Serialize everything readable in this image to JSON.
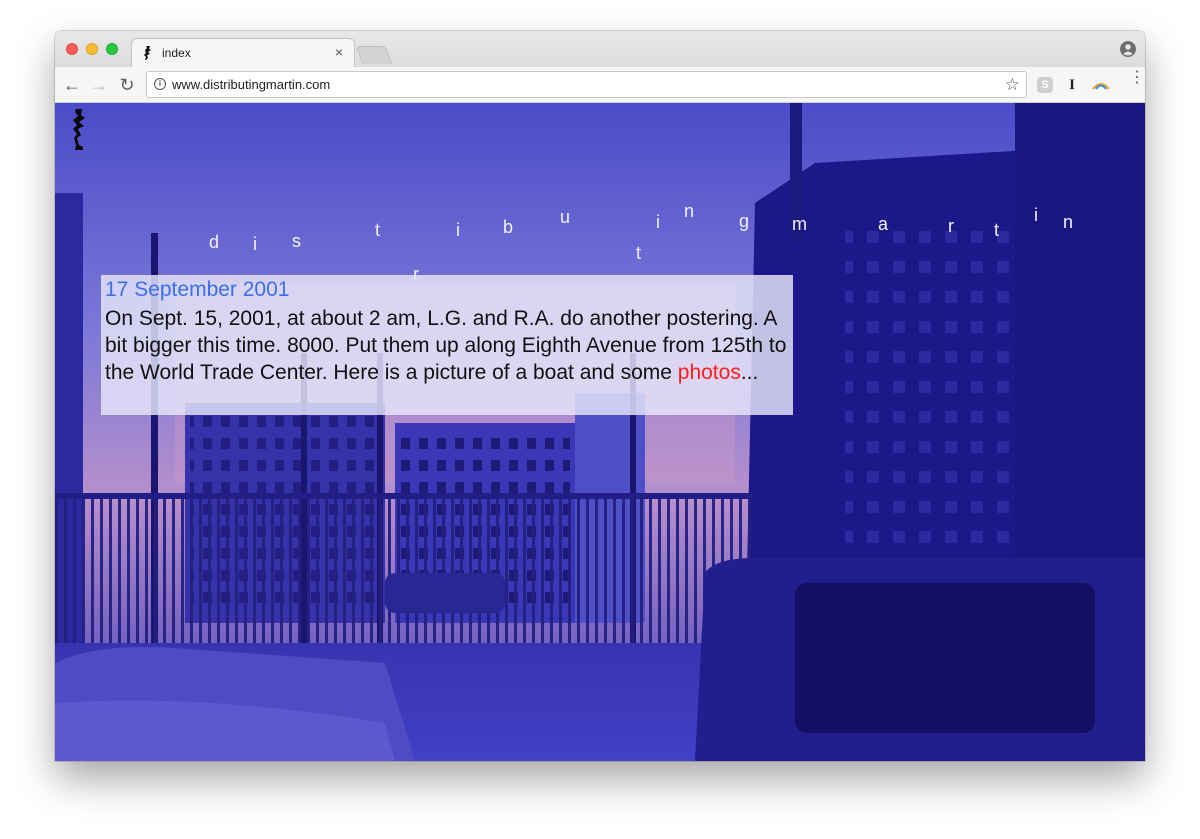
{
  "browser": {
    "tab": {
      "title": "index",
      "close_glyph": "×"
    },
    "toolbar": {
      "url": "www.distributingmartin.com",
      "back_glyph": "←",
      "forward_glyph": "→",
      "reload_glyph": "↻",
      "info_glyph": "i",
      "star_glyph": "☆",
      "menu_glyph": "⋮"
    },
    "extensions": {
      "skype_glyph": "S",
      "instapaper_glyph": "I"
    }
  },
  "site": {
    "wordmark_letters": [
      "d",
      "i",
      "s",
      "t",
      "r",
      "i",
      "b",
      "u",
      "t",
      "i",
      "n",
      "g",
      "m",
      "a",
      "r",
      "t",
      "i",
      "n"
    ],
    "entry": {
      "date": "17 September 2001",
      "text_before_link": "On Sept. 15, 2001, at about 2 am, L.G. and R.A. do another postering. A bit bigger this time. 8000. Put them up along Eighth Avenue from 125th to the World Trade Center. Here is a picture of a boat and some ",
      "link_text": "photos",
      "text_after_link": "..."
    }
  },
  "icons": {
    "traffic_close": "close-window-icon",
    "traffic_minimize": "minimize-window-icon",
    "traffic_maximize": "maximize-window-icon",
    "profile": "profile-icon",
    "info": "site-info-icon",
    "bookmark": "bookmark-star-icon",
    "menu": "browser-menu-icon"
  },
  "colors": {
    "entry_date": "#3a6ff0",
    "entry_link": "#ff1d1d",
    "entry_box": "#e8e6fa",
    "photo_tint": "#26249a"
  }
}
